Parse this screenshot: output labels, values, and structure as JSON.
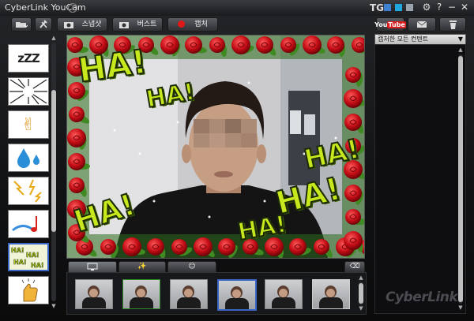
{
  "window": {
    "title": "CyberLink YouCam",
    "skin_label": "TG",
    "skin_colors": [
      "#3d7fd0",
      "#1fa8e0",
      "#9aa3ad"
    ],
    "controls": [
      "?",
      "−",
      "✕"
    ]
  },
  "toolbar": {
    "folder_icon": "folder-icon",
    "tools_icon": "tools-icon",
    "snapshot_label": "스냅샷",
    "burst_label": "버스트",
    "capture_label": "캡처",
    "capture_color": "#e01818"
  },
  "effects": {
    "items": [
      {
        "name": "effect-zzz",
        "glyph": "z Z Z"
      },
      {
        "name": "effect-burst-lines",
        "glyph": ""
      },
      {
        "name": "effect-peace-hand",
        "glyph": "✌"
      },
      {
        "name": "effect-water-drops",
        "glyph": "💧"
      },
      {
        "name": "effect-lightning",
        "glyph": "⚡"
      },
      {
        "name": "effect-music-note",
        "glyph": "♪"
      },
      {
        "name": "effect-haha",
        "glyph": "HA!HA!"
      },
      {
        "name": "effect-thumbs-up",
        "glyph": "👍"
      }
    ],
    "selected_index": 6
  },
  "preview": {
    "overlay_words": [
      "HA!",
      "HA!",
      "HA!",
      "HA!",
      "HA!",
      "HA!",
      "HA!"
    ]
  },
  "bottom_tabs": {
    "tabs": [
      "monitor-tab",
      "magic-wand-tab",
      "emoticon-tab"
    ],
    "eraser_icon": "eraser-icon"
  },
  "thumbnails": {
    "count": 6,
    "selected_index": 2
  },
  "right_panel": {
    "youtube_label": "You Tube",
    "email_icon": "email-icon",
    "trash_icon": "trash-icon",
    "filter_label": "캡처한 모든 컨텐트",
    "brand": "CyberLink"
  }
}
